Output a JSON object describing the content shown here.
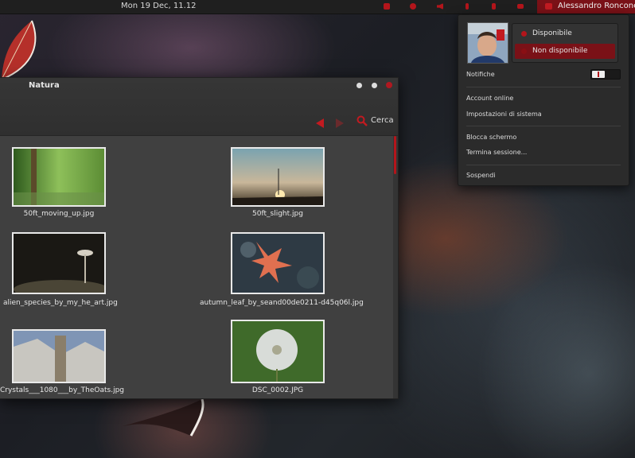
{
  "topbar": {
    "clock": "Mon 19 Dec, 11.12",
    "tray_icons": [
      "folder-icon",
      "clock-icon",
      "volume-icon",
      "bluetooth-icon",
      "network-icon",
      "mail-icon"
    ],
    "user_name": "Alessandro Roncone",
    "accent": "#b3151b"
  },
  "window": {
    "title": "Natura",
    "search_label": "Cerca",
    "files": [
      {
        "name": "50ft_moving_up.jpg"
      },
      {
        "name": "50ft_slight.jpg"
      },
      {
        "name": "alien_species_by_my_he_art.jpg"
      },
      {
        "name": "autumn_leaf_by_seand00de0211-d45q06l.jpg"
      },
      {
        "name": "Crystals___1080___by_TheOats.jpg"
      },
      {
        "name": "DSC_0002.JPG"
      }
    ]
  },
  "user_menu": {
    "status_available": "Disponibile",
    "status_unavailable": "Non disponibile",
    "notifications_label": "Notifiche",
    "items": {
      "online_accounts": "Account online",
      "system_settings": "Impostazioni di sistema",
      "lock_screen": "Blocca schermo",
      "logout": "Termina sessione...",
      "suspend": "Sospendi"
    }
  }
}
